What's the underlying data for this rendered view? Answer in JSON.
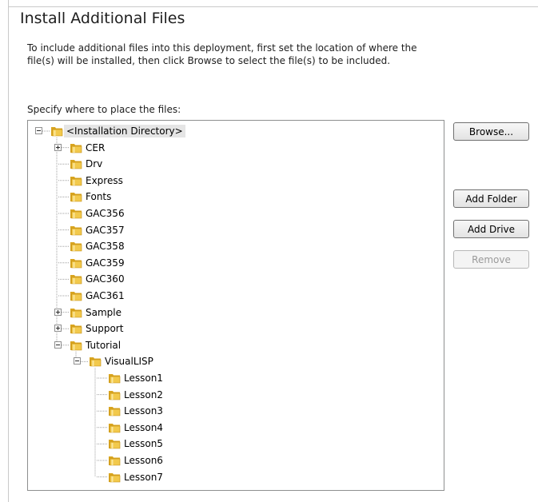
{
  "page": {
    "title": "Install Additional Files",
    "description_lines": [
      "To include additional files into this deployment, first set the location of where the",
      "file(s) will be installed, then click Browse to select the file(s) to be included."
    ],
    "tree_label": "Specify where to place the files:"
  },
  "tree": {
    "root": "<Installation Directory>",
    "children": [
      "CER",
      "Drv",
      "Express",
      "Fonts",
      "GAC356",
      "GAC357",
      "GAC358",
      "GAC359",
      "GAC360",
      "GAC361",
      "Sample",
      "Support",
      "Tutorial"
    ],
    "tutorial_child": "VisualLISP",
    "visuallisp_children": [
      "Lesson1",
      "Lesson2",
      "Lesson3",
      "Lesson4",
      "Lesson5",
      "Lesson6",
      "Lesson7"
    ]
  },
  "buttons": {
    "browse": "Browse...",
    "add_folder": "Add Folder",
    "add_drive": "Add Drive",
    "remove": "Remove"
  },
  "colors": {
    "folder_fill": "#f2c94c",
    "folder_dark": "#d9a520",
    "selection": "#e5e5e5"
  }
}
